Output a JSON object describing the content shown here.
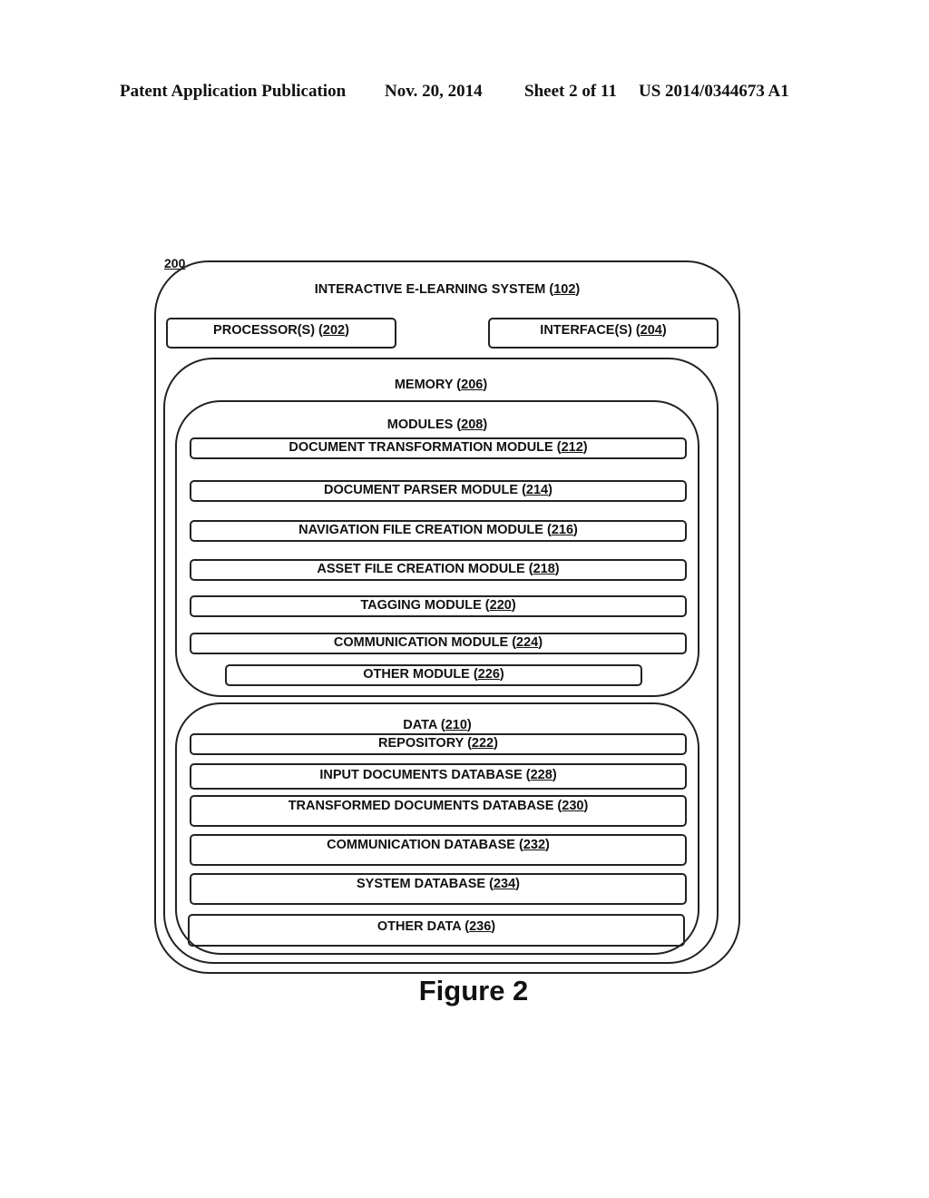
{
  "header": {
    "publication": "Patent Application Publication",
    "date": "Nov. 20, 2014",
    "sheet": "Sheet 2 of 11",
    "number": "US 2014/0344673 A1"
  },
  "figure": {
    "ref": "200",
    "caption": "Figure 2",
    "system": {
      "name": "INTERACTIVE E-LEARNING SYSTEM (",
      "ref": "102"
    },
    "processor": {
      "name": "PROCESSOR(S) (",
      "ref": "202"
    },
    "interface": {
      "name": "INTERFACE(S) (",
      "ref": "204"
    },
    "memory": {
      "name": "MEMORY (",
      "ref": "206"
    },
    "modules": {
      "name": "MODULES (",
      "ref": "208",
      "items": [
        {
          "name": "DOCUMENT TRANSFORMATION MODULE (",
          "ref": "212"
        },
        {
          "name": "DOCUMENT PARSER MODULE (",
          "ref": "214"
        },
        {
          "name": "NAVIGATION FILE CREATION MODULE (",
          "ref": "216"
        },
        {
          "name": "ASSET FILE CREATION MODULE (",
          "ref": "218"
        },
        {
          "name": "TAGGING MODULE (",
          "ref": "220"
        },
        {
          "name": "COMMUNICATION MODULE (",
          "ref": "224"
        },
        {
          "name": "OTHER MODULE (",
          "ref": "226"
        }
      ]
    },
    "data": {
      "name": "DATA (",
      "ref": "210",
      "items": [
        {
          "name": "REPOSITORY (",
          "ref": "222"
        },
        {
          "name": "INPUT DOCUMENTS DATABASE (",
          "ref": "228"
        },
        {
          "name": "TRANSFORMED DOCUMENTS DATABASE (",
          "ref": "230"
        },
        {
          "name": "COMMUNICATION DATABASE (",
          "ref": "232"
        },
        {
          "name": "SYSTEM DATABASE (",
          "ref": "234"
        },
        {
          "name": "OTHER DATA (",
          "ref": "236"
        }
      ]
    }
  }
}
